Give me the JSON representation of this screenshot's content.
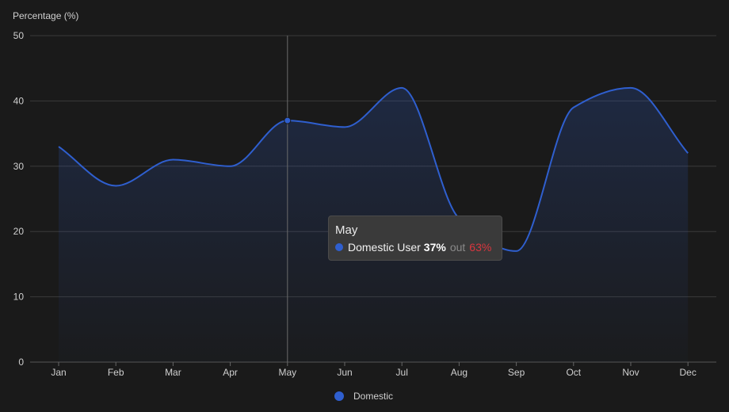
{
  "chart_data": {
    "type": "area",
    "categories": [
      "Jan",
      "Feb",
      "Mar",
      "Apr",
      "May",
      "Jun",
      "Jul",
      "Aug",
      "Sep",
      "Oct",
      "Nov",
      "Dec"
    ],
    "series": [
      {
        "name": "Domestic",
        "values": [
          33,
          27,
          31,
          30,
          37,
          36,
          42,
          22,
          17,
          39,
          42,
          32
        ]
      }
    ],
    "ylabel": "Percentage (%)",
    "ylim": [
      0,
      50
    ],
    "yticks": [
      0,
      10,
      20,
      30,
      40,
      50
    ],
    "grid": true,
    "legend_placement": "bottom-center",
    "colors": {
      "line": "#2f5fcf",
      "background": "#1a1a1a",
      "out_value": "#d9363e"
    }
  },
  "tooltip": {
    "category": "May",
    "series_label": "Domestic User",
    "value": "37%",
    "out_label": "out",
    "out_value": "63%"
  }
}
